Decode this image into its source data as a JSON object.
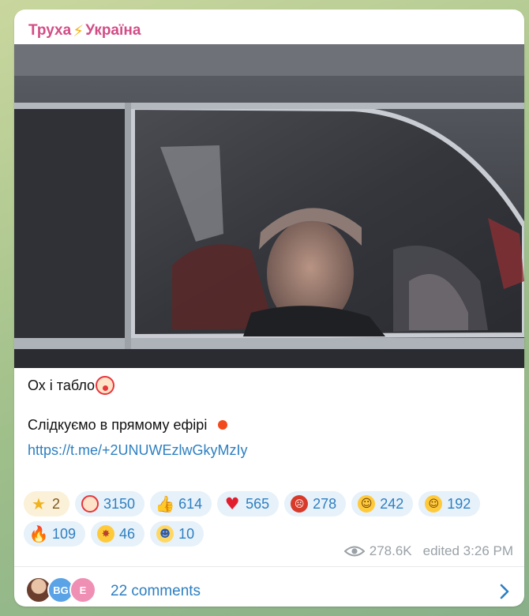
{
  "channel": {
    "name_part1": "Труха",
    "name_part2": "Україна",
    "separator_icon": "lightning-icon"
  },
  "post": {
    "photo_icon": "limousine-photo",
    "caption_line1": "Ох і табло",
    "caption_line2": "Слідкуємо в прямому ефірі",
    "link": "https://t.me/+2UNUWEzlwGkyMzIy"
  },
  "reactions": [
    {
      "icon": "star-icon",
      "count": "2"
    },
    {
      "icon": "clown-face-icon",
      "count": "3150"
    },
    {
      "icon": "thumbs-up-icon",
      "count": "614"
    },
    {
      "icon": "red-heart-icon",
      "count": "565"
    },
    {
      "icon": "angry-face-icon",
      "count": "278"
    },
    {
      "icon": "grinning-face-icon",
      "count": "242"
    },
    {
      "icon": "raised-eyebrow-face-icon",
      "count": "192"
    },
    {
      "icon": "fire-icon",
      "count": "109"
    },
    {
      "icon": "exploding-head-icon",
      "count": "46"
    },
    {
      "icon": "screaming-face-icon",
      "count": "10"
    }
  ],
  "meta": {
    "views": "278.6K",
    "edited": "edited 3:26 PM"
  },
  "comments": {
    "label": "22 comments",
    "avatar2_initials": "BG",
    "avatar3_initials": "E"
  }
}
